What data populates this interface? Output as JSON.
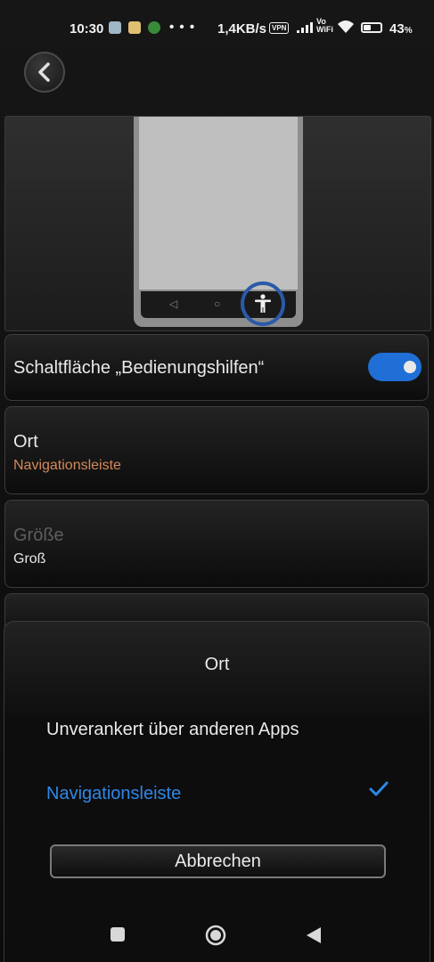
{
  "status_bar": {
    "time": "10:30",
    "dots": "• • •",
    "speed": "1,4KB/s",
    "vpn": "VPN",
    "vowifi_top": "Vo",
    "vowifi_bottom": "WiFi",
    "battery_pct": "43",
    "battery_pct_unit": "%",
    "battery_level": 0.43
  },
  "preview": {
    "nav_back": "◁",
    "nav_home": "○",
    "accessibility_icon": "accessibility-icon"
  },
  "settings": {
    "button_toggle": {
      "label": "Schaltfläche „Bedienungshilfen“",
      "enabled": true
    },
    "location": {
      "label": "Ort",
      "value": "Navigationsleiste"
    },
    "size": {
      "label": "Größe",
      "value": "Groß"
    }
  },
  "dialog": {
    "title": "Ort",
    "options": [
      {
        "label": "Unverankert über anderen Apps",
        "selected": false
      },
      {
        "label": "Navigationsleiste",
        "selected": true
      }
    ],
    "cancel_label": "Abbrechen"
  },
  "colors": {
    "accent": "#2e87e6",
    "value_orange": "#d4895a",
    "toggle_on": "#1f6fd6"
  }
}
